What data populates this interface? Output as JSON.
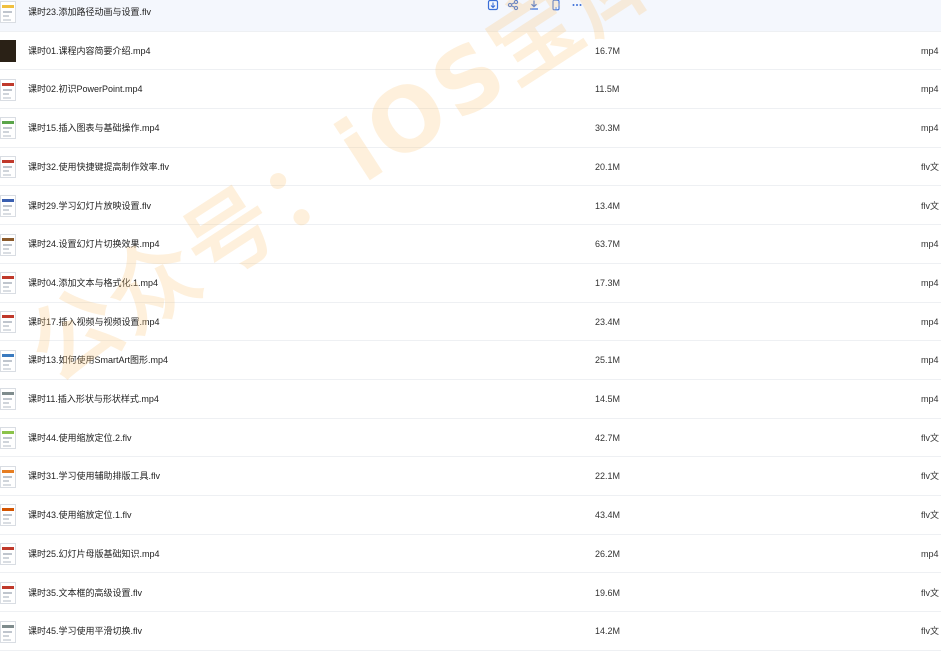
{
  "files": [
    {
      "name": "课时23.添加路径动画与设置.flv",
      "size": "",
      "type": "",
      "thumb": "slide",
      "bar": "#f0c040",
      "hover": true
    },
    {
      "name": "课时01.课程内容简要介绍.mp4",
      "size": "16.7M",
      "type": "mp4",
      "thumb": "dark",
      "bar": "#2a2116"
    },
    {
      "name": "课时02.初识PowerPoint.mp4",
      "size": "11.5M",
      "type": "mp4",
      "thumb": "slide",
      "bar": "#c0392b"
    },
    {
      "name": "课时15.插入图表与基础操作.mp4",
      "size": "30.3M",
      "type": "mp4",
      "thumb": "slide",
      "bar": "#5aa54a"
    },
    {
      "name": "课时32.使用快捷键提高制作效率.flv",
      "size": "20.1M",
      "type": "flv文",
      "thumb": "slide",
      "bar": "#c0392b"
    },
    {
      "name": "课时29.学习幻灯片放映设置.flv",
      "size": "13.4M",
      "type": "flv文",
      "thumb": "slide",
      "bar": "#3a5fb0"
    },
    {
      "name": "课时24.设置幻灯片切换效果.mp4",
      "size": "63.7M",
      "type": "mp4",
      "thumb": "slide",
      "bar": "#8b5a2b"
    },
    {
      "name": "课时04.添加文本与格式化.1.mp4",
      "size": "17.3M",
      "type": "mp4",
      "thumb": "slide",
      "bar": "#c0392b"
    },
    {
      "name": "课时17.插入视频与视频设置.mp4",
      "size": "23.4M",
      "type": "mp4",
      "thumb": "slide",
      "bar": "#c0392b"
    },
    {
      "name": "课时13.如何使用SmartArt图形.mp4",
      "size": "25.1M",
      "type": "mp4",
      "thumb": "slide",
      "bar": "#3a7abf"
    },
    {
      "name": "课时11.插入形状与形状样式.mp4",
      "size": "14.5M",
      "type": "mp4",
      "thumb": "slide",
      "bar": "#7f8c8d"
    },
    {
      "name": "课时44.使用缩放定位.2.flv",
      "size": "42.7M",
      "type": "flv文",
      "thumb": "slide",
      "bar": "#8bc34a"
    },
    {
      "name": "课时31.学习使用辅助排版工具.flv",
      "size": "22.1M",
      "type": "flv文",
      "thumb": "slide",
      "bar": "#e67e22"
    },
    {
      "name": "课时43.使用缩放定位.1.flv",
      "size": "43.4M",
      "type": "flv文",
      "thumb": "slide",
      "bar": "#d35400"
    },
    {
      "name": "课时25.幻灯片母版基础知识.mp4",
      "size": "26.2M",
      "type": "mp4",
      "thumb": "slide",
      "bar": "#c0392b"
    },
    {
      "name": "课时35.文本框的高级设置.flv",
      "size": "19.6M",
      "type": "flv文",
      "thumb": "slide",
      "bar": "#c0392b"
    },
    {
      "name": "课时45.学习使用平滑切换.flv",
      "size": "14.2M",
      "type": "flv文",
      "thumb": "slide",
      "bar": "#7f8c8d"
    }
  ],
  "actions": [
    {
      "icon": "save-to-drive-icon"
    },
    {
      "icon": "share-icon"
    },
    {
      "icon": "download-icon"
    },
    {
      "icon": "phone-icon"
    },
    {
      "icon": "more-icon"
    }
  ],
  "watermark": "公众号：iOS宝库",
  "colors": {
    "accent": "#3b6fd8",
    "watermark": "#f5b778"
  }
}
